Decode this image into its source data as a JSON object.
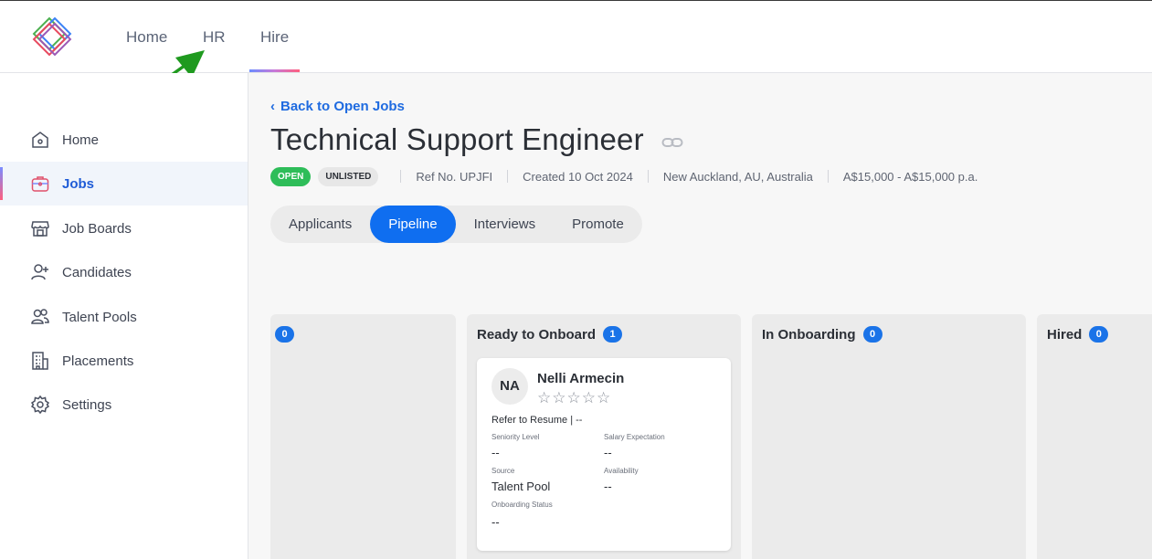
{
  "topnav": {
    "home": "Home",
    "hr": "HR",
    "hire": "Hire"
  },
  "sidebar": {
    "items": [
      {
        "label": "Home",
        "icon": "home-icon"
      },
      {
        "label": "Jobs",
        "icon": "briefcase-icon",
        "active": true
      },
      {
        "label": "Job Boards",
        "icon": "storefront-icon"
      },
      {
        "label": "Candidates",
        "icon": "add-user-icon"
      },
      {
        "label": "Talent Pools",
        "icon": "users-icon"
      },
      {
        "label": "Placements",
        "icon": "building-icon"
      },
      {
        "label": "Settings",
        "icon": "gear-icon"
      }
    ]
  },
  "job": {
    "back_label": "Back to Open Jobs",
    "title": "Technical Support Engineer",
    "status": "OPEN",
    "visibility": "UNLISTED",
    "ref": "Ref No. UPJFI",
    "created": "Created 10 Oct 2024",
    "location": "New Auckland, AU, Australia",
    "salary": "A$15,000 - A$15,000 p.a."
  },
  "tabs": [
    "Applicants",
    "Pipeline",
    "Interviews",
    "Promote"
  ],
  "active_tab": "Pipeline",
  "pipeline": {
    "columns": [
      {
        "title": "",
        "count": "0"
      },
      {
        "title": "Ready to Onboard",
        "count": "1"
      },
      {
        "title": "In Onboarding",
        "count": "0"
      },
      {
        "title": "Hired",
        "count": "0"
      }
    ],
    "card": {
      "initials": "NA",
      "name": "Nelli Armecin",
      "stars": "☆☆☆☆☆",
      "resume": "Refer to Resume | --",
      "seniority_label": "Seniority Level",
      "seniority_value": "--",
      "salary_label": "Salary Expectation",
      "salary_value": "--",
      "source_label": "Source",
      "source_value": "Talent Pool",
      "availability_label": "Availability",
      "availability_value": "--",
      "onboarding_label": "Onboarding Status",
      "onboarding_value": "--"
    }
  },
  "colors": {
    "accent": "#0f6ef0",
    "open_badge": "#2ebd59",
    "arrow": "#1f9a1f"
  }
}
